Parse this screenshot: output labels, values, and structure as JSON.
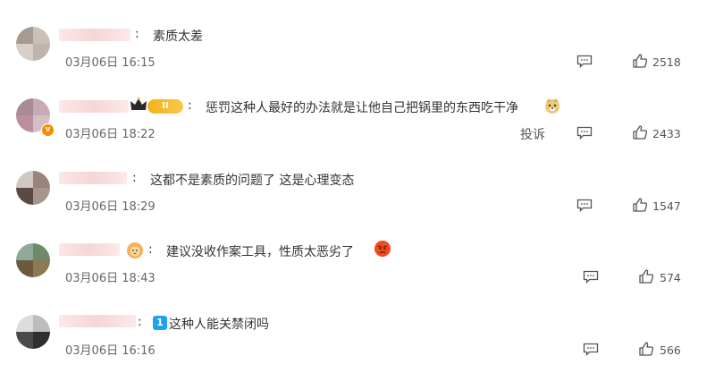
{
  "comments": [
    {
      "text": "素质太差",
      "time": "03月06日 16:15",
      "likes": "2518"
    },
    {
      "text": "惩罚这种人最好的办法就是让他自己把锅里的东西吃干净",
      "time": "03月06日 18:22",
      "likes": "2433",
      "report": "投诉",
      "level_badge": "II"
    },
    {
      "text": "这都不是素质的问题了 这是心理变态",
      "time": "03月06日 18:29",
      "likes": "1547"
    },
    {
      "text": "建议没收作案工具，性质太恶劣了",
      "time": "03月06日 18:43",
      "likes": "574"
    },
    {
      "text": "这种人能关禁闭吗",
      "time": "03月06日 16:16",
      "likes": "566",
      "badge": "1"
    }
  ],
  "colon": ":"
}
